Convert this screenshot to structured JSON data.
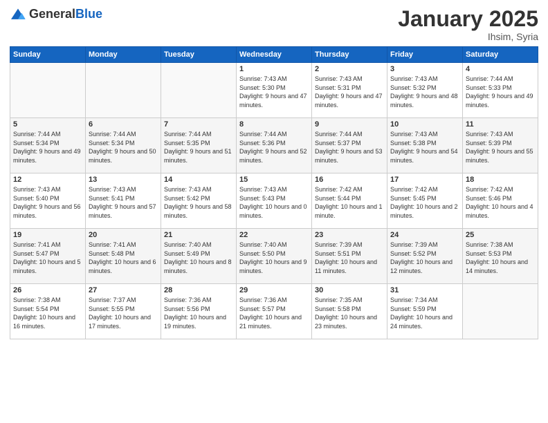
{
  "header": {
    "logo_general": "General",
    "logo_blue": "Blue",
    "title": "January 2025",
    "location": "Ihsim, Syria"
  },
  "days_of_week": [
    "Sunday",
    "Monday",
    "Tuesday",
    "Wednesday",
    "Thursday",
    "Friday",
    "Saturday"
  ],
  "weeks": [
    [
      {
        "day": "",
        "info": ""
      },
      {
        "day": "",
        "info": ""
      },
      {
        "day": "",
        "info": ""
      },
      {
        "day": "1",
        "info": "Sunrise: 7:43 AM\nSunset: 5:30 PM\nDaylight: 9 hours and 47 minutes."
      },
      {
        "day": "2",
        "info": "Sunrise: 7:43 AM\nSunset: 5:31 PM\nDaylight: 9 hours and 47 minutes."
      },
      {
        "day": "3",
        "info": "Sunrise: 7:43 AM\nSunset: 5:32 PM\nDaylight: 9 hours and 48 minutes."
      },
      {
        "day": "4",
        "info": "Sunrise: 7:44 AM\nSunset: 5:33 PM\nDaylight: 9 hours and 49 minutes."
      }
    ],
    [
      {
        "day": "5",
        "info": "Sunrise: 7:44 AM\nSunset: 5:34 PM\nDaylight: 9 hours and 49 minutes."
      },
      {
        "day": "6",
        "info": "Sunrise: 7:44 AM\nSunset: 5:34 PM\nDaylight: 9 hours and 50 minutes."
      },
      {
        "day": "7",
        "info": "Sunrise: 7:44 AM\nSunset: 5:35 PM\nDaylight: 9 hours and 51 minutes."
      },
      {
        "day": "8",
        "info": "Sunrise: 7:44 AM\nSunset: 5:36 PM\nDaylight: 9 hours and 52 minutes."
      },
      {
        "day": "9",
        "info": "Sunrise: 7:44 AM\nSunset: 5:37 PM\nDaylight: 9 hours and 53 minutes."
      },
      {
        "day": "10",
        "info": "Sunrise: 7:43 AM\nSunset: 5:38 PM\nDaylight: 9 hours and 54 minutes."
      },
      {
        "day": "11",
        "info": "Sunrise: 7:43 AM\nSunset: 5:39 PM\nDaylight: 9 hours and 55 minutes."
      }
    ],
    [
      {
        "day": "12",
        "info": "Sunrise: 7:43 AM\nSunset: 5:40 PM\nDaylight: 9 hours and 56 minutes."
      },
      {
        "day": "13",
        "info": "Sunrise: 7:43 AM\nSunset: 5:41 PM\nDaylight: 9 hours and 57 minutes."
      },
      {
        "day": "14",
        "info": "Sunrise: 7:43 AM\nSunset: 5:42 PM\nDaylight: 9 hours and 58 minutes."
      },
      {
        "day": "15",
        "info": "Sunrise: 7:43 AM\nSunset: 5:43 PM\nDaylight: 10 hours and 0 minutes."
      },
      {
        "day": "16",
        "info": "Sunrise: 7:42 AM\nSunset: 5:44 PM\nDaylight: 10 hours and 1 minute."
      },
      {
        "day": "17",
        "info": "Sunrise: 7:42 AM\nSunset: 5:45 PM\nDaylight: 10 hours and 2 minutes."
      },
      {
        "day": "18",
        "info": "Sunrise: 7:42 AM\nSunset: 5:46 PM\nDaylight: 10 hours and 4 minutes."
      }
    ],
    [
      {
        "day": "19",
        "info": "Sunrise: 7:41 AM\nSunset: 5:47 PM\nDaylight: 10 hours and 5 minutes."
      },
      {
        "day": "20",
        "info": "Sunrise: 7:41 AM\nSunset: 5:48 PM\nDaylight: 10 hours and 6 minutes."
      },
      {
        "day": "21",
        "info": "Sunrise: 7:40 AM\nSunset: 5:49 PM\nDaylight: 10 hours and 8 minutes."
      },
      {
        "day": "22",
        "info": "Sunrise: 7:40 AM\nSunset: 5:50 PM\nDaylight: 10 hours and 9 minutes."
      },
      {
        "day": "23",
        "info": "Sunrise: 7:39 AM\nSunset: 5:51 PM\nDaylight: 10 hours and 11 minutes."
      },
      {
        "day": "24",
        "info": "Sunrise: 7:39 AM\nSunset: 5:52 PM\nDaylight: 10 hours and 12 minutes."
      },
      {
        "day": "25",
        "info": "Sunrise: 7:38 AM\nSunset: 5:53 PM\nDaylight: 10 hours and 14 minutes."
      }
    ],
    [
      {
        "day": "26",
        "info": "Sunrise: 7:38 AM\nSunset: 5:54 PM\nDaylight: 10 hours and 16 minutes."
      },
      {
        "day": "27",
        "info": "Sunrise: 7:37 AM\nSunset: 5:55 PM\nDaylight: 10 hours and 17 minutes."
      },
      {
        "day": "28",
        "info": "Sunrise: 7:36 AM\nSunset: 5:56 PM\nDaylight: 10 hours and 19 minutes."
      },
      {
        "day": "29",
        "info": "Sunrise: 7:36 AM\nSunset: 5:57 PM\nDaylight: 10 hours and 21 minutes."
      },
      {
        "day": "30",
        "info": "Sunrise: 7:35 AM\nSunset: 5:58 PM\nDaylight: 10 hours and 23 minutes."
      },
      {
        "day": "31",
        "info": "Sunrise: 7:34 AM\nSunset: 5:59 PM\nDaylight: 10 hours and 24 minutes."
      },
      {
        "day": "",
        "info": ""
      }
    ]
  ]
}
